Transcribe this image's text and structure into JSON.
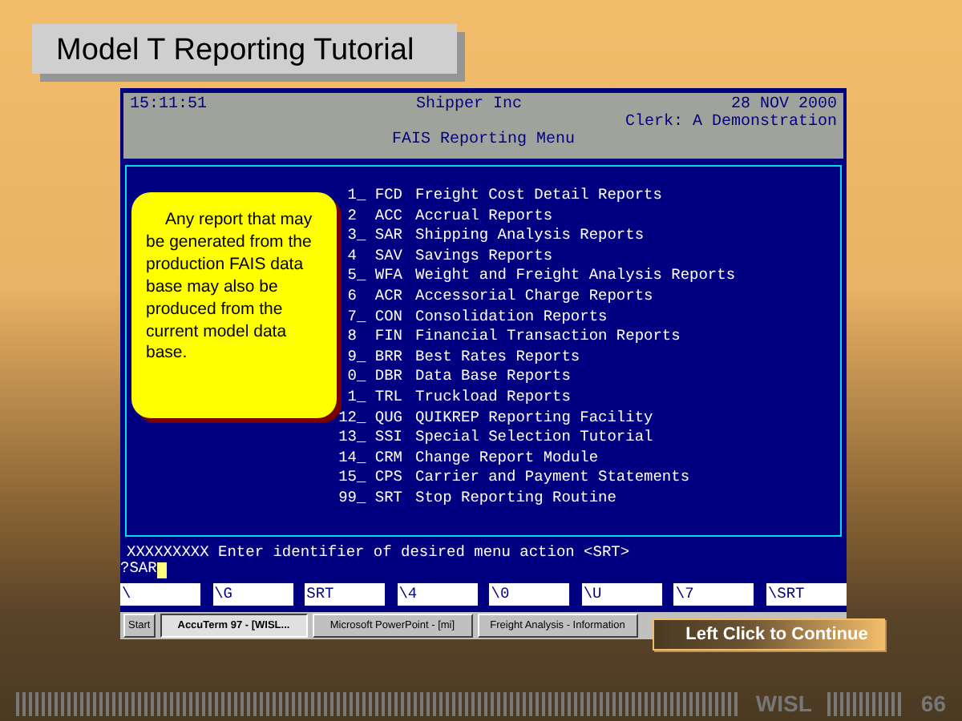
{
  "slide_title": "Model T Reporting Tutorial",
  "terminal": {
    "time": "15:11:51",
    "company": "Shipper Inc",
    "date": "28 NOV 2000",
    "clerk": "Clerk: A Demonstration",
    "menu_title": "FAIS Reporting Menu",
    "menu": [
      {
        "code": "1_ FCD",
        "label": "Freight Cost Detail Reports"
      },
      {
        "code": "2  ACC",
        "label": "Accrual Reports"
      },
      {
        "code": "3_ SAR",
        "label": "Shipping Analysis Reports"
      },
      {
        "code": "4  SAV",
        "label": "Savings Reports"
      },
      {
        "code": "5_ WFA",
        "label": "Weight and Freight Analysis Reports"
      },
      {
        "code": "6  ACR",
        "label": "Accessorial Charge Reports"
      },
      {
        "code": "7_ CON",
        "label": "Consolidation Reports"
      },
      {
        "code": "8  FIN",
        "label": "Financial Transaction Reports"
      },
      {
        "code": "9_ BRR",
        "label": "Best Rates Reports"
      },
      {
        "code": "0_ DBR",
        "label": "Data Base Reports"
      },
      {
        "code": "1_ TRL",
        "label": "Truckload Reports"
      },
      {
        "code": "12_ QUG",
        "label": "QUIKREP Reporting Facility"
      },
      {
        "code": "13_ SSI",
        "label": "Special Selection Tutorial"
      },
      {
        "code": "14_ CRM",
        "label": "Change Report Module"
      },
      {
        "code": "15_ CPS",
        "label": "Carrier and Payment Statements"
      },
      {
        "code": "99_ SRT",
        "label": "Stop Reporting Routine"
      }
    ],
    "prompt": "XXXXXXXXX Enter identifier of desired menu action <SRT>",
    "input": "?SAR",
    "function_keys": [
      "\\",
      "\\G",
      "SRT",
      "\\4",
      "\\0",
      "\\U",
      "\\7",
      "\\SRT"
    ]
  },
  "callout": "Any report that may be generated from the production FAIS data base may also be produced from the current model data base.",
  "taskbar": {
    "start": "Start",
    "tasks": [
      {
        "label": "AccuTerm 97 - [WISL...",
        "selected": true
      },
      {
        "label": "Microsoft PowerPoint - [mi]",
        "selected": false
      },
      {
        "label": "Freight Analysis - Information",
        "selected": false
      }
    ]
  },
  "continue_button": "Left Click to Continue",
  "footer": {
    "brand": "WISL",
    "page": "66"
  }
}
